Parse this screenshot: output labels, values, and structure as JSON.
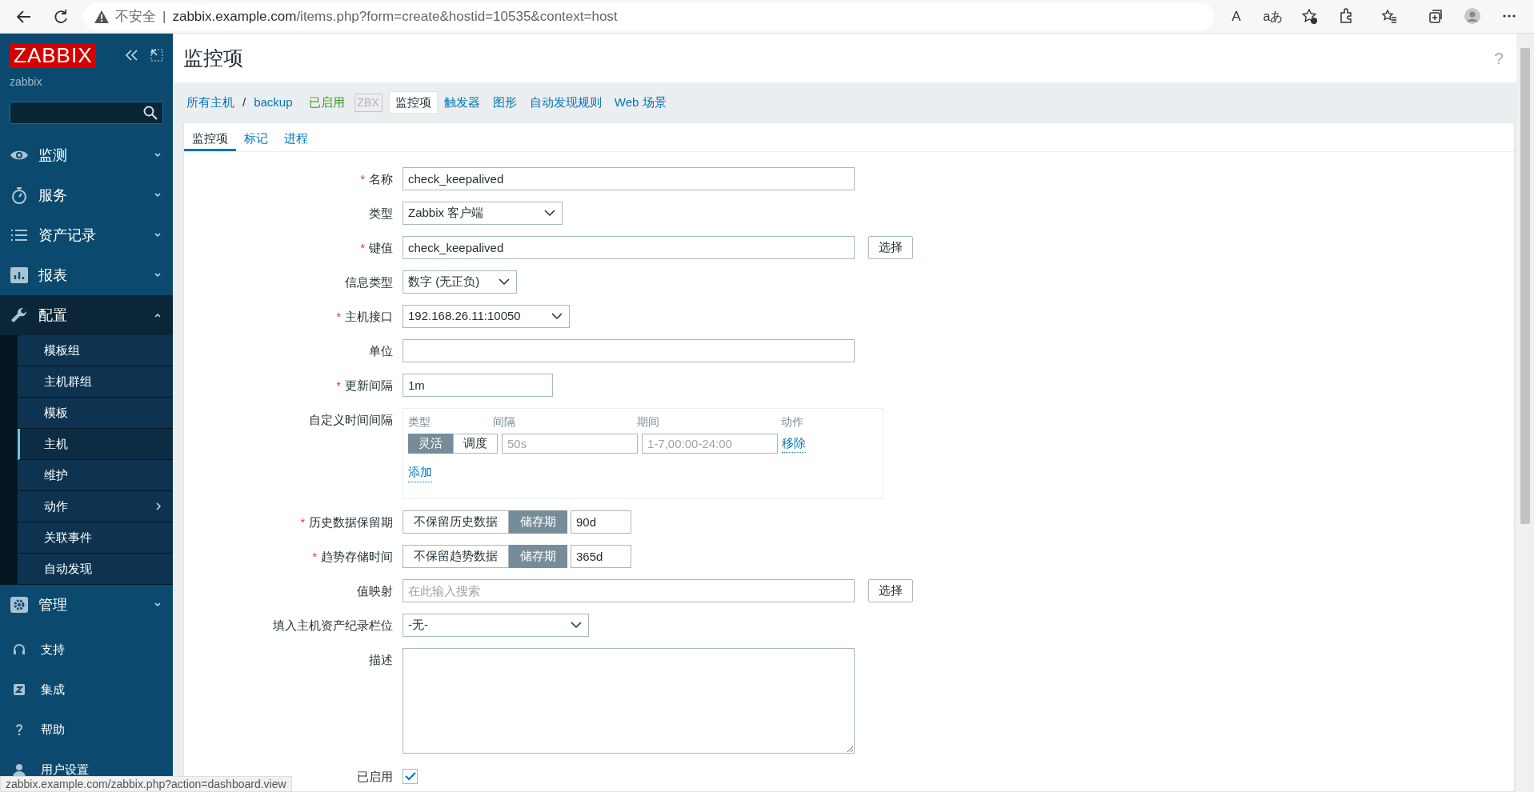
{
  "browser": {
    "security": "不安全",
    "separator": "|",
    "url_host": "zabbix.example.com",
    "url_path": "/items.php?form=create&hostid=10535&context=host",
    "read_aloud": "A",
    "translate": "aあ"
  },
  "sidebar": {
    "logo": "ZABBIX",
    "server": "zabbix",
    "menu": [
      {
        "label": "监测",
        "expanded": false
      },
      {
        "label": "服务",
        "expanded": false
      },
      {
        "label": "资产记录",
        "expanded": false
      },
      {
        "label": "报表",
        "expanded": false
      },
      {
        "label": "配置",
        "expanded": true,
        "children": [
          {
            "label": "模板组",
            "selected": false,
            "has_submenu": false
          },
          {
            "label": "主机群组",
            "selected": false,
            "has_submenu": false
          },
          {
            "label": "模板",
            "selected": false,
            "has_submenu": false
          },
          {
            "label": "主机",
            "selected": true,
            "has_submenu": false
          },
          {
            "label": "维护",
            "selected": false,
            "has_submenu": false
          },
          {
            "label": "动作",
            "selected": false,
            "has_submenu": true
          },
          {
            "label": "关联事件",
            "selected": false,
            "has_submenu": false
          },
          {
            "label": "自动发现",
            "selected": false,
            "has_submenu": false
          }
        ]
      },
      {
        "label": "管理",
        "expanded": false
      }
    ],
    "footer": [
      {
        "label": "支持"
      },
      {
        "label": "集成"
      },
      {
        "label": "帮助"
      },
      {
        "label": "用户设置"
      }
    ]
  },
  "page": {
    "title": "监控项",
    "help": "?"
  },
  "breadcrumb": {
    "all_hosts": "所有主机",
    "separator": "/",
    "host": "backup",
    "status": "已启用",
    "agent": "ZBX",
    "tabs": [
      {
        "label": "监控项",
        "selected": true
      },
      {
        "label": "触发器",
        "selected": false
      },
      {
        "label": "图形",
        "selected": false
      },
      {
        "label": "自动发现规则",
        "selected": false
      },
      {
        "label": "Web 场景",
        "selected": false
      }
    ]
  },
  "required_mark": "*",
  "form_tabs": [
    {
      "label": "监控项",
      "selected": true
    },
    {
      "label": "标记",
      "selected": false
    },
    {
      "label": "进程",
      "selected": false
    }
  ],
  "fields": [
    {
      "kind": "text",
      "label": "名称",
      "required": true,
      "value": "check_keepalived"
    },
    {
      "kind": "select",
      "label": "类型",
      "required": false,
      "value": "Zabbix 客户端"
    },
    {
      "kind": "text",
      "label": "键值",
      "required": true,
      "value": "check_keepalived",
      "button": "选择"
    },
    {
      "kind": "select",
      "label": "信息类型",
      "required": false,
      "value": "数字 (无正负)"
    },
    {
      "kind": "select",
      "label": "主机接口",
      "required": true,
      "value": "192.168.26.11:10050"
    },
    {
      "kind": "text",
      "label": "单位",
      "required": false
    },
    {
      "kind": "text",
      "label": "更新间隔",
      "required": true,
      "value": "1m"
    },
    {
      "kind": "intervals",
      "label": "自定义时间间隔",
      "required": false,
      "headers": [
        "类型",
        "间隔",
        "期间",
        "动作"
      ],
      "rows": [
        {
          "modes": [
            {
              "label": "灵活",
              "selected": true
            },
            {
              "label": "调度",
              "selected": false
            }
          ],
          "interval_placeholder": "50s",
          "period_placeholder": "1-7,00:00-24:00",
          "action": "移除"
        }
      ],
      "add": "添加"
    },
    {
      "kind": "storage",
      "label": "历史数据保留期",
      "required": true,
      "options": [
        {
          "label": "不保留历史数据",
          "selected": false
        },
        {
          "label": "储存期",
          "selected": true
        }
      ],
      "value": "90d"
    },
    {
      "kind": "storage",
      "label": "趋势存储时间",
      "required": true,
      "options": [
        {
          "label": "不保留趋势数据",
          "selected": false
        },
        {
          "label": "储存期",
          "selected": true
        }
      ],
      "value": "365d"
    },
    {
      "kind": "text",
      "label": "值映射",
      "required": false,
      "placeholder": "在此输入搜索",
      "button": "选择"
    },
    {
      "kind": "select",
      "label": "填入主机资产纪录栏位",
      "required": false,
      "value": "-无-"
    },
    {
      "kind": "textarea",
      "label": "描述",
      "required": false
    },
    {
      "kind": "checkbox",
      "label": "已启用",
      "required": false,
      "checked": true
    }
  ],
  "status_url": "zabbix.example.com/zabbix.php?action=dashboard.view"
}
